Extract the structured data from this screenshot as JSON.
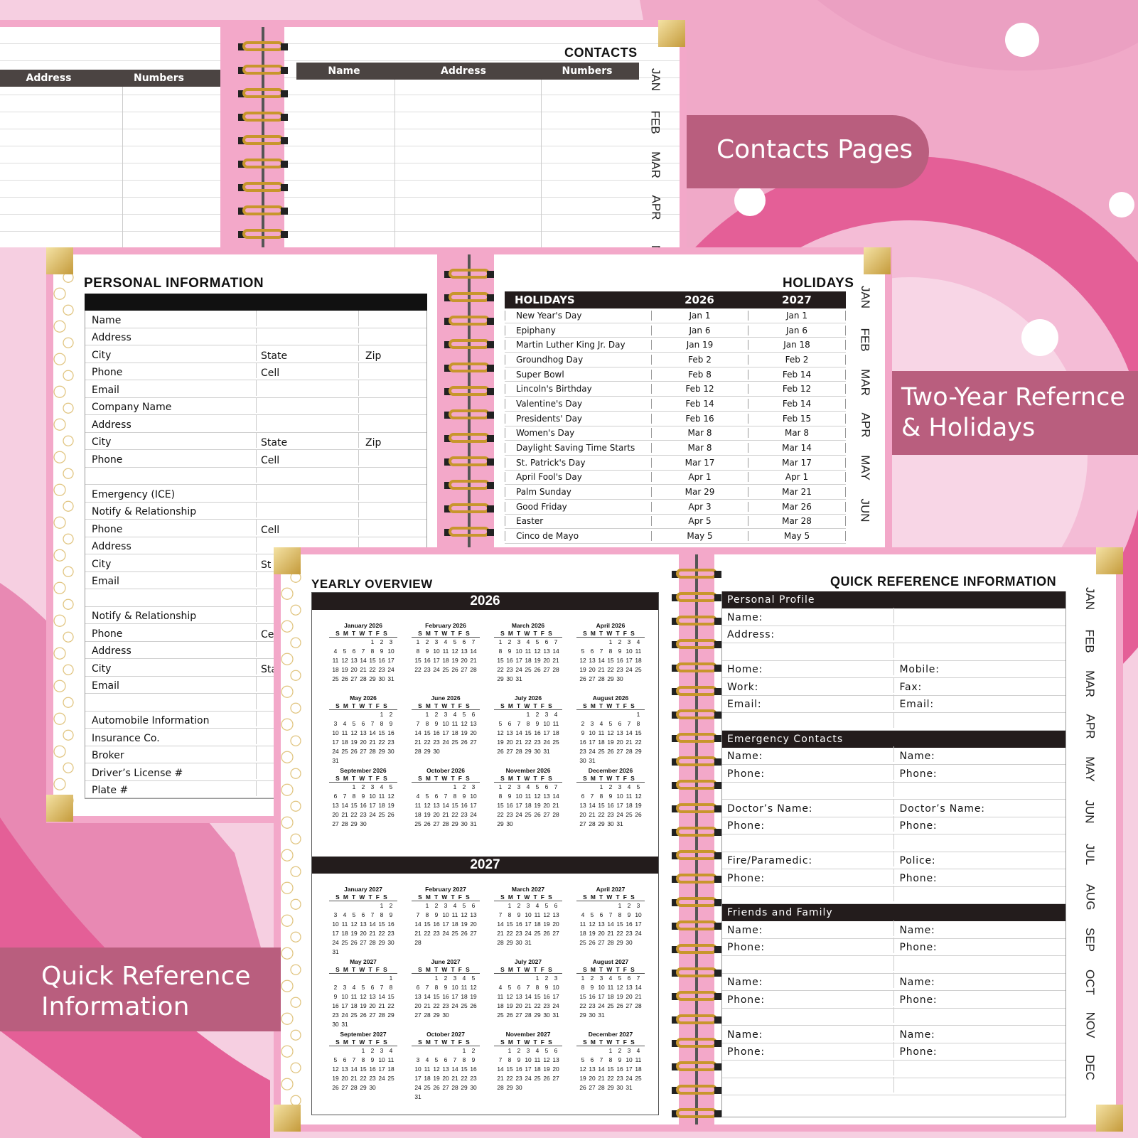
{
  "callouts": {
    "contacts": "Contacts Pages",
    "holidays_line1": "Two-Year Refernce",
    "holidays_line2": "& Holidays",
    "quick_line1": "Quick Reference",
    "quick_line2": "Information"
  },
  "colors": {
    "callout": "#b95e7e",
    "header": "#231c1c",
    "ring": "#c8962c",
    "background": "#f6cfe1"
  },
  "contacts": {
    "title": "CONTACTS",
    "left_columns": [
      "Address",
      "Numbers"
    ],
    "right_columns": [
      "Name",
      "Address",
      "Numbers"
    ],
    "tabs": [
      "JAN",
      "FEB",
      "MAR",
      "APR",
      "M"
    ]
  },
  "personal": {
    "title": "PERSONAL INFORMATION",
    "rows": [
      {
        "a": "Name",
        "b": "",
        "c": ""
      },
      {
        "a": "Address",
        "b": "",
        "c": ""
      },
      {
        "a": "City",
        "b": "State",
        "c": "Zip"
      },
      {
        "a": "Phone",
        "b": "Cell",
        "c": ""
      },
      {
        "a": "Email",
        "b": "",
        "c": ""
      },
      {
        "a": "Company Name",
        "b": "",
        "c": ""
      },
      {
        "a": "Address",
        "b": "",
        "c": ""
      },
      {
        "a": "City",
        "b": "State",
        "c": "Zip"
      },
      {
        "a": "Phone",
        "b": "Cell",
        "c": ""
      },
      {
        "a": "",
        "b": "",
        "c": ""
      },
      {
        "a": "Emergency (ICE)",
        "b": "",
        "c": ""
      },
      {
        "a": "Notify & Relationship",
        "b": "",
        "c": ""
      },
      {
        "a": "Phone",
        "b": "Cell",
        "c": ""
      },
      {
        "a": "Address",
        "b": "",
        "c": ""
      },
      {
        "a": "City",
        "b": "St",
        "c": ""
      },
      {
        "a": "Email",
        "b": "",
        "c": ""
      },
      {
        "a": "",
        "b": "",
        "c": ""
      },
      {
        "a": "Notify & Relationship",
        "b": "",
        "c": ""
      },
      {
        "a": "Phone",
        "b": "Ce",
        "c": ""
      },
      {
        "a": "Address",
        "b": "",
        "c": ""
      },
      {
        "a": "City",
        "b": "Sta",
        "c": ""
      },
      {
        "a": "Email",
        "b": "",
        "c": ""
      },
      {
        "a": "",
        "b": "",
        "c": ""
      },
      {
        "a": "Automobile Information",
        "b": "",
        "c": ""
      },
      {
        "a": "Insurance Co.",
        "b": "",
        "c": ""
      },
      {
        "a": "Broker",
        "b": "",
        "c": ""
      },
      {
        "a": "Driver’s License #",
        "b": "",
        "c": ""
      },
      {
        "a": "Plate #",
        "b": "",
        "c": ""
      }
    ]
  },
  "holidays": {
    "title": "HOLIDAYS",
    "columns": [
      "HOLIDAYS",
      "2026",
      "2027"
    ],
    "tabs": [
      "JAN",
      "FEB",
      "MAR",
      "APR",
      "MAY",
      "JUN"
    ],
    "rows": [
      [
        "New Year's Day",
        "Jan 1",
        "Jan 1"
      ],
      [
        "Epiphany",
        "Jan 6",
        "Jan 6"
      ],
      [
        "Martin Luther King Jr. Day",
        "Jan 19",
        "Jan 18"
      ],
      [
        "Groundhog Day",
        "Feb 2",
        "Feb 2"
      ],
      [
        "Super Bowl",
        "Feb 8",
        "Feb 14"
      ],
      [
        "Lincoln's Birthday",
        "Feb 12",
        "Feb 12"
      ],
      [
        "Valentine's Day",
        "Feb 14",
        "Feb 14"
      ],
      [
        "Presidents' Day",
        "Feb 16",
        "Feb 15"
      ],
      [
        "Women's Day",
        "Mar 8",
        "Mar 8"
      ],
      [
        "Daylight Saving Time Starts",
        "Mar 8",
        "Mar 14"
      ],
      [
        "St. Patrick's Day",
        "Mar 17",
        "Mar 17"
      ],
      [
        "April Fool's Day",
        "Apr 1",
        "Apr 1"
      ],
      [
        "Palm Sunday",
        "Mar 29",
        "Mar 21"
      ],
      [
        "Good Friday",
        "Apr 3",
        "Mar 26"
      ],
      [
        "Easter",
        "Apr 5",
        "Mar 28"
      ],
      [
        "Cinco de Mayo",
        "May 5",
        "May 5"
      ]
    ]
  },
  "yearly": {
    "title": "YEARLY OVERVIEW",
    "weekday_header": "SMTWTFS",
    "years": [
      {
        "label": "2026",
        "months": [
          {
            "name": "January 2026",
            "offset": 4,
            "days": 31
          },
          {
            "name": "February 2026",
            "offset": 0,
            "days": 28
          },
          {
            "name": "March 2026",
            "offset": 0,
            "days": 31
          },
          {
            "name": "April 2026",
            "offset": 3,
            "days": 30
          },
          {
            "name": "May 2026",
            "offset": 5,
            "days": 31
          },
          {
            "name": "June 2026",
            "offset": 1,
            "days": 30
          },
          {
            "name": "July 2026",
            "offset": 3,
            "days": 31
          },
          {
            "name": "August 2026",
            "offset": 6,
            "days": 31
          },
          {
            "name": "September 2026",
            "offset": 2,
            "days": 30
          },
          {
            "name": "October 2026",
            "offset": 4,
            "days": 31
          },
          {
            "name": "November 2026",
            "offset": 0,
            "days": 30
          },
          {
            "name": "December 2026",
            "offset": 2,
            "days": 31
          }
        ]
      },
      {
        "label": "2027",
        "months": [
          {
            "name": "January 2027",
            "offset": 5,
            "days": 31
          },
          {
            "name": "February 2027",
            "offset": 1,
            "days": 28
          },
          {
            "name": "March 2027",
            "offset": 1,
            "days": 31
          },
          {
            "name": "April 2027",
            "offset": 4,
            "days": 30
          },
          {
            "name": "May 2027",
            "offset": 6,
            "days": 31
          },
          {
            "name": "June 2027",
            "offset": 2,
            "days": 30
          },
          {
            "name": "July 2027",
            "offset": 4,
            "days": 31
          },
          {
            "name": "August 2027",
            "offset": 0,
            "days": 31
          },
          {
            "name": "September 2027",
            "offset": 3,
            "days": 30
          },
          {
            "name": "October 2027",
            "offset": 5,
            "days": 31
          },
          {
            "name": "November 2027",
            "offset": 1,
            "days": 30
          },
          {
            "name": "December 2027",
            "offset": 3,
            "days": 31
          }
        ]
      }
    ]
  },
  "quick": {
    "title": "QUICK REFERENCE INFORMATION",
    "tabs": [
      "JAN",
      "FEB",
      "MAR",
      "APR",
      "MAY",
      "JUN",
      "JUL",
      "AUG",
      "SEP",
      "OCT",
      "NOV",
      "DEC"
    ],
    "sections": [
      {
        "heading": "Personal Profile",
        "rows": [
          [
            "Name:",
            ""
          ],
          [
            "Address:",
            ""
          ],
          [
            "",
            ""
          ],
          [
            "Home:",
            "Mobile:"
          ],
          [
            "Work:",
            "Fax:"
          ],
          [
            "Email:",
            "Email:"
          ],
          [
            "",
            ""
          ]
        ]
      },
      {
        "heading": "Emergency Contacts",
        "rows": [
          [
            "Name:",
            "Name:"
          ],
          [
            "Phone:",
            "Phone:"
          ],
          [
            "",
            ""
          ],
          [
            "Doctor’s Name:",
            "Doctor’s  Name:"
          ],
          [
            "Phone:",
            "Phone:"
          ],
          [
            "",
            ""
          ],
          [
            "Fire/Paramedic:",
            "Police:"
          ],
          [
            "Phone:",
            "Phone:"
          ],
          [
            "",
            ""
          ]
        ]
      },
      {
        "heading": "Friends and Family",
        "rows": [
          [
            "Name:",
            "Name:"
          ],
          [
            "Phone:",
            "Phone:"
          ],
          [
            "",
            ""
          ],
          [
            "Name:",
            "Name:"
          ],
          [
            "Phone:",
            "Phone:"
          ],
          [
            "",
            ""
          ],
          [
            "Name:",
            "Name:"
          ],
          [
            "Phone:",
            "Phone:"
          ],
          [
            "",
            ""
          ],
          [
            "",
            ""
          ]
        ]
      }
    ]
  }
}
